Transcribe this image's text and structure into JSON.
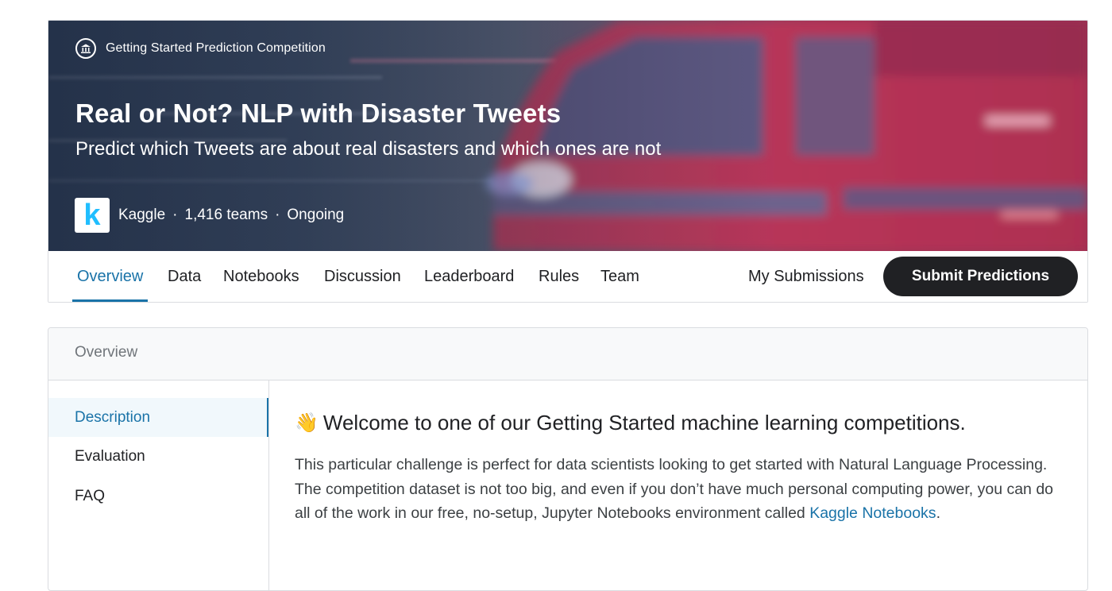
{
  "competition": {
    "kind": "Getting Started Prediction Competition",
    "kind_icon": "institution-icon",
    "title": "Real or Not? NLP with Disaster Tweets",
    "subtitle": "Predict which Tweets are about real disasters and which ones are not",
    "host": "Kaggle",
    "host_logo_letter": "k",
    "teams": "1,416 teams",
    "status": "Ongoing",
    "separator": "·"
  },
  "tabs": [
    {
      "label": "Overview",
      "active": true
    },
    {
      "label": "Data"
    },
    {
      "label": "Notebooks"
    },
    {
      "label": "Discussion"
    },
    {
      "label": "Leaderboard"
    },
    {
      "label": "Rules"
    },
    {
      "label": "Team"
    }
  ],
  "actions": {
    "my_submissions": "My Submissions",
    "submit": "Submit Predictions"
  },
  "overview": {
    "header": "Overview",
    "nav": [
      {
        "label": "Description",
        "active": true
      },
      {
        "label": "Evaluation"
      },
      {
        "label": "FAQ"
      }
    ],
    "heading_emoji": "👋",
    "heading": "Welcome to one of our Getting Started machine learning competitions.",
    "paragraph": "This particular challenge is perfect for data scientists looking to get started with Natural Language Processing. The competition dataset is not too big, and even if you don’t have much personal computing power, you can do all of the work in our free, no-setup, Jupyter Notebooks environment called ",
    "link_text": "Kaggle Notebooks",
    "paragraph_end": "."
  },
  "colors": {
    "accent": "#1a73a8",
    "button_dark": "#202124",
    "kaggle_blue": "#20beff"
  }
}
